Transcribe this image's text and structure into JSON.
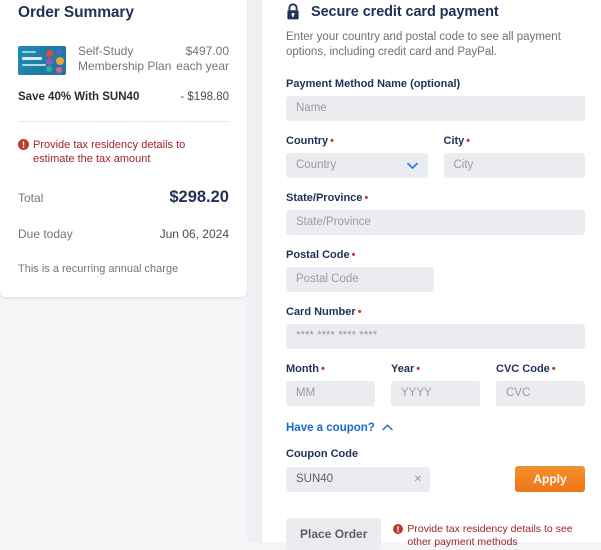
{
  "order_summary": {
    "title": "Order Summary",
    "item": {
      "name_line1": "Self-Study",
      "name_line2": "Membership Plan",
      "price": "$497.00",
      "period": "each year",
      "thumbnail_icon": "course-thumbnail-image"
    },
    "discount": {
      "label": "Save 40% With SUN40",
      "value": "- $198.80"
    },
    "tax_warning": {
      "icon": "alert-circle-icon",
      "text": "Provide tax residency details to estimate the tax amount"
    },
    "total": {
      "label": "Total",
      "value": "$298.20"
    },
    "due": {
      "label": "Due today",
      "value": "Jun 06, 2024"
    },
    "recurring_note": "This is a recurring annual charge"
  },
  "payment": {
    "lock_icon": "lock-icon",
    "title": "Secure credit card payment",
    "subtitle": "Enter your country and postal code to see all payment options, including credit card and PayPal.",
    "fields": {
      "payment_method_name": {
        "label": "Payment Method Name (optional)",
        "placeholder": "Name",
        "value": ""
      },
      "country": {
        "label": "Country",
        "required_mark": "•",
        "placeholder": "Country",
        "value": "",
        "chevron_icon": "chevron-down-icon"
      },
      "city": {
        "label": "City",
        "required_mark": "•",
        "placeholder": "City",
        "value": ""
      },
      "state_province": {
        "label": "State/Province",
        "required_mark": "•",
        "placeholder": "State/Province",
        "value": ""
      },
      "postal_code": {
        "label": "Postal Code",
        "required_mark": "•",
        "placeholder": "Postal Code",
        "value": ""
      },
      "card_number": {
        "label": "Card Number",
        "required_mark": "•",
        "placeholder": "**** **** **** ****",
        "value": ""
      },
      "month": {
        "label": "Month",
        "required_mark": "•",
        "placeholder": "MM",
        "value": ""
      },
      "year": {
        "label": "Year",
        "required_mark": "•",
        "placeholder": "YYYY",
        "value": ""
      },
      "cvc": {
        "label": "CVC Code",
        "required_mark": "•",
        "placeholder": "CVC",
        "value": ""
      }
    },
    "coupon": {
      "toggle_label": "Have a coupon?",
      "toggle_icon": "chevron-up-icon",
      "label": "Coupon Code",
      "value": "SUN40",
      "clear_icon": "clear-x-icon",
      "apply_label": "Apply"
    },
    "place_order": {
      "label": "Place Order",
      "warning_icon": "alert-circle-icon",
      "warning_text": "Provide tax residency details to see other payment methods"
    }
  },
  "colors": {
    "navy": "#1f3157",
    "orange": "#ef7617",
    "link_blue": "#1a6bc9",
    "warning_red": "#a3232b",
    "input_bg": "#ebecef",
    "page_bg": "#f4f5f7"
  }
}
